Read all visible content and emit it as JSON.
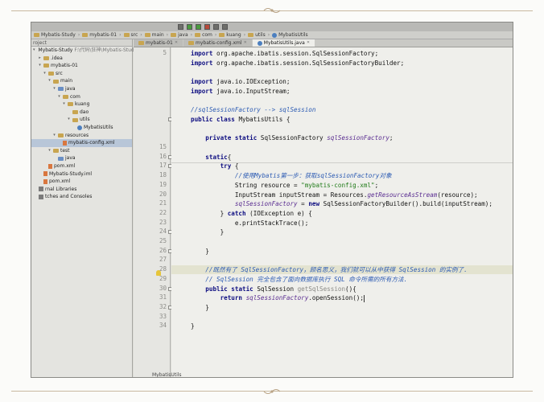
{
  "toolbar": {
    "icons": [
      "build-icon",
      "run-icon",
      "debug-icon",
      "stop-icon",
      "coverage-icon",
      "search-icon"
    ]
  },
  "breadcrumb": [
    "Mybatis-Study",
    "mybatis-01",
    "src",
    "main",
    "java",
    "com",
    "kuang",
    "utils",
    "MybatisUtils"
  ],
  "project_panel": {
    "header": "roject",
    "tree": [
      {
        "label": "Mybatis-Study",
        "suffix": " F:\\代码\\狂神\\Mybatis-Study [18520] 1",
        "icon": "folder",
        "arrow": "▾",
        "indent": 0
      },
      {
        "label": ".idea",
        "icon": "folder",
        "arrow": "▸",
        "indent": 1
      },
      {
        "label": "mybatis-01",
        "icon": "folder",
        "arrow": "▾",
        "indent": 1
      },
      {
        "label": "src",
        "icon": "folder",
        "arrow": "▾",
        "indent": 2
      },
      {
        "label": "main",
        "icon": "folder",
        "arrow": "▾",
        "indent": 3
      },
      {
        "label": "java",
        "icon": "folder-blue",
        "arrow": "▾",
        "indent": 4
      },
      {
        "label": "com",
        "icon": "folder",
        "arrow": "▾",
        "indent": 5
      },
      {
        "label": "kuang",
        "icon": "folder",
        "arrow": "▾",
        "indent": 6
      },
      {
        "label": "dao",
        "icon": "folder",
        "arrow": "",
        "indent": 7
      },
      {
        "label": "utils",
        "icon": "folder",
        "arrow": "▾",
        "indent": 7
      },
      {
        "label": "MybatisUtils",
        "icon": "class",
        "arrow": "",
        "indent": 8
      },
      {
        "label": "resources",
        "icon": "folder",
        "arrow": "▾",
        "indent": 4
      },
      {
        "label": "mybatis-config.xml",
        "icon": "file",
        "arrow": "",
        "indent": 5,
        "selected": true
      },
      {
        "label": "test",
        "icon": "folder",
        "arrow": "▾",
        "indent": 3
      },
      {
        "label": "java",
        "icon": "folder-blue",
        "arrow": "",
        "indent": 4
      },
      {
        "label": "pom.xml",
        "icon": "file",
        "arrow": "",
        "indent": 2
      },
      {
        "label": "Mybatis-Study.iml",
        "icon": "file",
        "arrow": "",
        "indent": 1
      },
      {
        "label": "pom.xml",
        "icon": "file",
        "arrow": "",
        "indent": 1
      },
      {
        "label": "rnal Libraries",
        "icon": "lib",
        "arrow": "",
        "indent": 0
      },
      {
        "label": "tches and Consoles",
        "icon": "lib",
        "arrow": "",
        "indent": 0
      }
    ]
  },
  "tabs": [
    {
      "label": "mybatis-01",
      "active": false
    },
    {
      "label": "mybatis-config.xml",
      "active": false
    },
    {
      "label": "MybatisUtils.java",
      "active": true
    }
  ],
  "gutter": {
    "numbers": [
      "5",
      "",
      "",
      "",
      "",
      "",
      "",
      "",
      "",
      "",
      "15",
      "16",
      "17",
      "18",
      "19",
      "20",
      "21",
      "22",
      "23",
      "24",
      "25",
      "26",
      "27",
      "28",
      "29",
      "30",
      "31",
      "32",
      "33",
      "34"
    ]
  },
  "code": {
    "lines": [
      {
        "n": 0,
        "segs": [
          [
            "kw",
            "import "
          ],
          [
            "",
            "org.apache.ibatis.session.SqlSessionFactory;"
          ]
        ]
      },
      {
        "n": 1,
        "segs": [
          [
            "kw",
            "import "
          ],
          [
            "",
            "org.apache.ibatis.session.SqlSessionFactoryBuilder;"
          ]
        ]
      },
      {
        "n": 2,
        "segs": []
      },
      {
        "n": 3,
        "segs": [
          [
            "kw",
            "import "
          ],
          [
            "",
            "java.io.IOException;"
          ]
        ]
      },
      {
        "n": 4,
        "segs": [
          [
            "kw",
            "import "
          ],
          [
            "",
            "java.io.InputStream;"
          ]
        ]
      },
      {
        "n": 5,
        "segs": []
      },
      {
        "n": 6,
        "segs": [
          [
            "cmt",
            "//sqlSessionFactory --> sqlSession"
          ]
        ]
      },
      {
        "n": 7,
        "segs": [
          [
            "kw",
            "public class "
          ],
          [
            "",
            "MybatisUtils {"
          ]
        ]
      },
      {
        "n": 8,
        "segs": []
      },
      {
        "n": 9,
        "segs": [
          [
            "",
            "    "
          ],
          [
            "kw",
            "private static "
          ],
          [
            "",
            "SqlSessionFactory "
          ],
          [
            "ital",
            "sqlSessionFactory"
          ],
          [
            "",
            ";"
          ]
        ]
      },
      {
        "n": 10,
        "segs": []
      },
      {
        "n": 11,
        "segs": [
          [
            "",
            "    "
          ],
          [
            "kw",
            "static"
          ],
          [
            "",
            "{"
          ]
        ]
      },
      {
        "n": 12,
        "segs": [
          [
            "",
            "        "
          ],
          [
            "kw",
            "try "
          ],
          [
            "",
            "{"
          ]
        ]
      },
      {
        "n": 13,
        "segs": [
          [
            "",
            "            "
          ],
          [
            "cmt",
            "//使用Mybatis第一步：获取sqlSessionFactory对象"
          ]
        ]
      },
      {
        "n": 14,
        "segs": [
          [
            "",
            "            String resource = "
          ],
          [
            "str",
            "\"mybatis-config.xml\""
          ],
          [
            "",
            ";"
          ]
        ]
      },
      {
        "n": 15,
        "segs": [
          [
            "",
            "            InputStream inputStream = Resources."
          ],
          [
            "ital",
            "getResourceAsStream"
          ],
          [
            "",
            "(resource);"
          ]
        ]
      },
      {
        "n": 16,
        "segs": [
          [
            "",
            "            "
          ],
          [
            "ital",
            "sqlSessionFactory"
          ],
          [
            "",
            " = "
          ],
          [
            "kw",
            "new "
          ],
          [
            "",
            "SqlSessionFactoryBuilder().build(inputStream);"
          ]
        ]
      },
      {
        "n": 17,
        "segs": [
          [
            "",
            "        } "
          ],
          [
            "kw",
            "catch "
          ],
          [
            "",
            "(IOException e) {"
          ]
        ]
      },
      {
        "n": 18,
        "segs": [
          [
            "",
            "            e.printStackTrace();"
          ]
        ]
      },
      {
        "n": 19,
        "segs": [
          [
            "",
            "        }"
          ]
        ]
      },
      {
        "n": 20,
        "segs": []
      },
      {
        "n": 21,
        "segs": [
          [
            "",
            "    }"
          ]
        ]
      },
      {
        "n": 22,
        "segs": []
      },
      {
        "n": 23,
        "segs": [
          [
            "",
            "    "
          ],
          [
            "cmt",
            "//既然有了 SqlSessionFactory，顾名思义，我们就可以从中获得 SqlSession 的实例了."
          ]
        ]
      },
      {
        "n": 24,
        "segs": [
          [
            "",
            "    "
          ],
          [
            "cmt",
            "// SqlSession 完全包含了面向数据库执行 SQL 命令所需的所有方法."
          ]
        ]
      },
      {
        "n": 25,
        "segs": [
          [
            "",
            "    "
          ],
          [
            "kw",
            "public static "
          ],
          [
            "",
            "SqlSession "
          ],
          [
            "gray",
            "getSqlSession"
          ],
          [
            "",
            "(){"
          ]
        ]
      },
      {
        "n": 26,
        "segs": [
          [
            "",
            "        "
          ],
          [
            "kw",
            "return "
          ],
          [
            "ital",
            "sqlSessionFactory"
          ],
          [
            "",
            ".openSession();"
          ]
        ]
      },
      {
        "n": 27,
        "segs": [
          [
            "",
            "    }"
          ]
        ]
      },
      {
        "n": 28,
        "segs": []
      },
      {
        "n": 29,
        "segs": [
          [
            "",
            "}"
          ]
        ]
      }
    ]
  },
  "status": {
    "label": "MybatisUtils"
  }
}
